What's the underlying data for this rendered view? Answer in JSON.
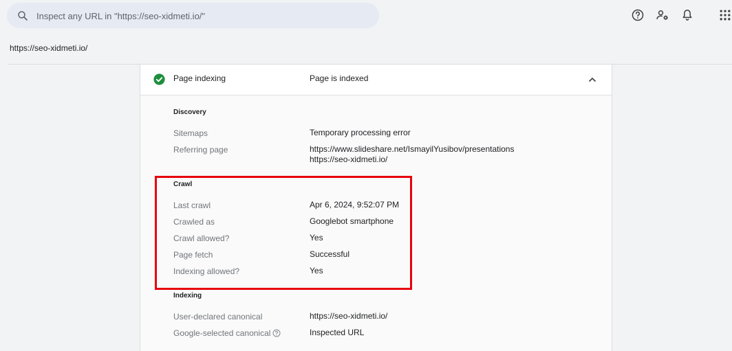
{
  "search": {
    "placeholder": "Inspect any URL in \"https://seo-xidmeti.io/\""
  },
  "toolbar": {
    "icons": [
      "help-icon",
      "manage-users-icon",
      "notifications-icon",
      "apps-grid-icon"
    ]
  },
  "inspected_url": "https://seo-xidmeti.io/",
  "card": {
    "header_label": "Page indexing",
    "header_value": "Page is indexed",
    "status_color": "#1e8e3e",
    "sections": {
      "discovery": {
        "title": "Discovery",
        "rows": [
          {
            "label": "Sitemaps",
            "value": "Temporary processing error"
          },
          {
            "label": "Referring page",
            "values": [
              "https://www.slideshare.net/IsmayilYusibov/presentations",
              "https://seo-xidmeti.io/"
            ]
          }
        ]
      },
      "crawl": {
        "title": "Crawl",
        "rows": [
          {
            "label": "Last crawl",
            "value": "Apr 6, 2024, 9:52:07 PM"
          },
          {
            "label": "Crawled as",
            "value": "Googlebot smartphone"
          },
          {
            "label": "Crawl allowed?",
            "value": "Yes"
          },
          {
            "label": "Page fetch",
            "value": "Successful"
          },
          {
            "label": "Indexing allowed?",
            "value": "Yes"
          }
        ]
      },
      "indexing": {
        "title": "Indexing",
        "rows": [
          {
            "label": "User-declared canonical",
            "value": "https://seo-xidmeti.io/"
          },
          {
            "label": "Google-selected canonical",
            "value": "Inspected URL"
          }
        ]
      }
    }
  },
  "highlight_color": "#e8000b"
}
